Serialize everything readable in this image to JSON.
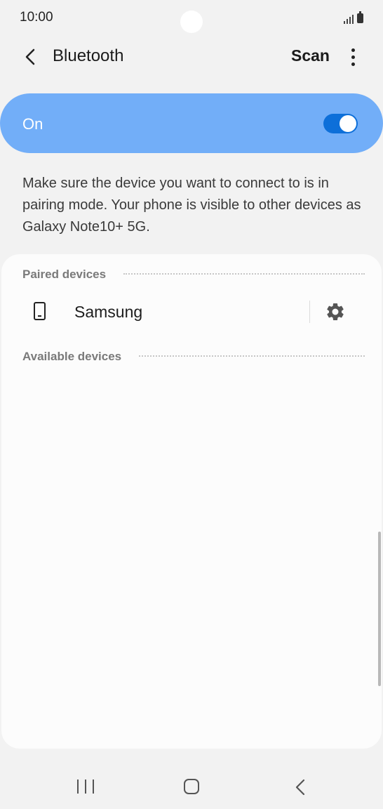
{
  "status_bar": {
    "time": "10:00",
    "icons": [
      "signal-icon",
      "battery-icon"
    ]
  },
  "header": {
    "title": "Bluetooth",
    "scan_label": "Scan",
    "icons": [
      "back-arrow-icon",
      "more-options-icon"
    ]
  },
  "toggle": {
    "label": "On",
    "state": "on",
    "bar_color": "#72aef8",
    "switch_color": "#0d6fd9"
  },
  "description": "Make sure the device you want to connect to is in pairing mode. Your phone is visible to other devices as Galaxy Note10+ 5G.",
  "paired_section": {
    "title": "Paired devices",
    "devices": [
      {
        "name": "Samsung",
        "icon": "phone-icon",
        "settings_icon": "gear-icon"
      }
    ]
  },
  "available_section": {
    "title": "Available devices",
    "devices": []
  },
  "nav_bar": {
    "icons": [
      "recent-apps-icon",
      "home-icon",
      "back-icon"
    ]
  }
}
